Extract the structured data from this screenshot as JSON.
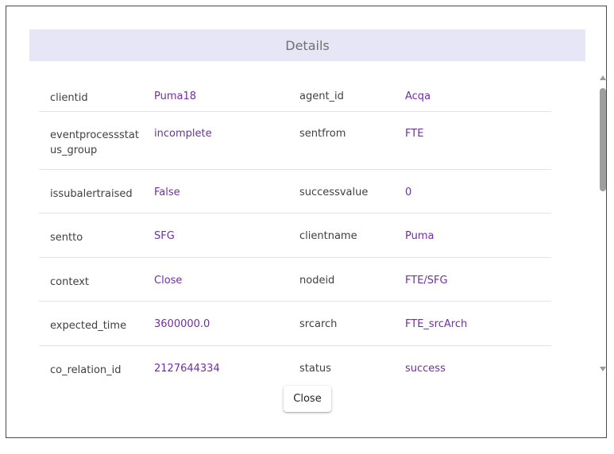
{
  "dialog": {
    "title": "Details",
    "close_label": "Close"
  },
  "rows": [
    {
      "key1": "clientid",
      "val1": "Puma18",
      "key2": "agent_id",
      "val2": "Acqa"
    },
    {
      "key1": "eventprocessstat us_group",
      "val1": "incomplete",
      "key2": "sentfrom",
      "val2": "FTE"
    },
    {
      "key1": "issubalertraised",
      "val1": "False",
      "key2": "successvalue",
      "val2": "0"
    },
    {
      "key1": "sentto",
      "val1": "SFG",
      "key2": "clientname",
      "val2": "Puma"
    },
    {
      "key1": "context",
      "val1": "Close",
      "key2": "nodeid",
      "val2": "FTE/SFG"
    },
    {
      "key1": "expected_time",
      "val1": "3600000.0",
      "key2": "srcarch",
      "val2": "FTE_srcArch"
    },
    {
      "key1": "co_relation_id",
      "val1": "2127644334",
      "key2": "status",
      "val2": "success"
    }
  ],
  "colors": {
    "header_bg": "#e6e6f7",
    "value_text": "#6f2fa0"
  }
}
